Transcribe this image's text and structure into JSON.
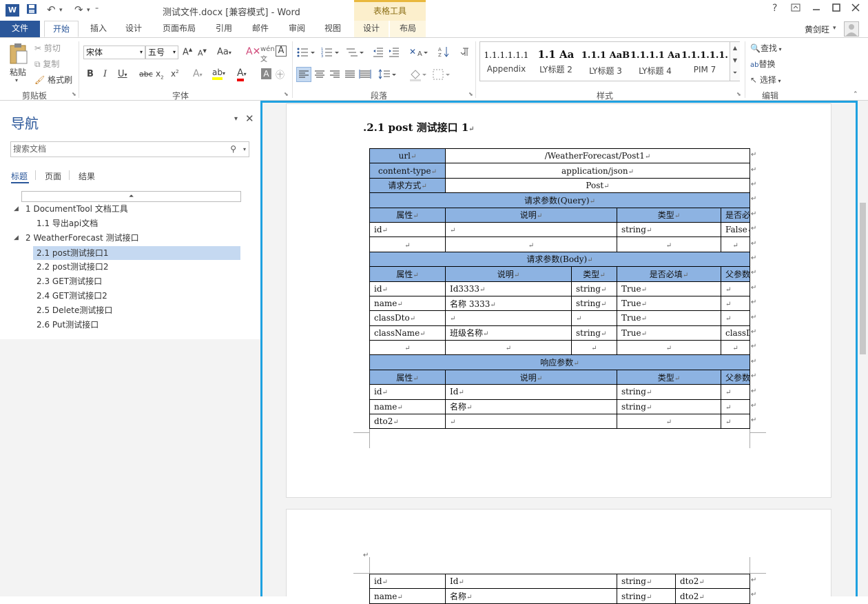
{
  "titlebar": {
    "app_icon": "W",
    "title": "测试文件.docx [兼容模式] - Word",
    "context_group": "表格工具",
    "help": "?",
    "icons": [
      "word-icon",
      "save-icon",
      "undo-icon",
      "redo-icon",
      "customize-qat-icon",
      "help-icon",
      "ribbon-display-icon",
      "minimize-icon",
      "maximize-icon",
      "close-icon"
    ]
  },
  "tabs": [
    "文件",
    "开始",
    "插入",
    "设计",
    "页面布局",
    "引用",
    "邮件",
    "审阅",
    "视图",
    "设计",
    "布局"
  ],
  "user": {
    "name": "黄剑旺"
  },
  "ribbon": {
    "clipboard": {
      "paste": "粘贴",
      "cut": "剪切",
      "copy": "复制",
      "format_painter": "格式刷",
      "label": "剪贴板"
    },
    "font": {
      "font_name": "宋体",
      "font_size": "五号",
      "label": "字体",
      "case": "Aa"
    },
    "paragraph": {
      "label": "段落"
    },
    "styles": {
      "label": "样式",
      "items": [
        {
          "preview": "1.1.1.1.1.1",
          "name": "Appendix"
        },
        {
          "preview": "1.1 Aa",
          "name": "LY标题 2"
        },
        {
          "preview": "1.1.1 AaB",
          "name": "LY标题 3"
        },
        {
          "preview": "1.1.1.1 Aa",
          "name": "LY标题 4"
        },
        {
          "preview": "1.1.1.1.1.",
          "name": "PIM 7"
        }
      ]
    },
    "editing": {
      "find": "查找",
      "replace": "替换",
      "select": "选择",
      "label": "编辑"
    }
  },
  "nav": {
    "title": "导航",
    "search_placeholder": "搜索文档",
    "tabs": [
      "标题",
      "页面",
      "结果"
    ],
    "tree": [
      {
        "text": "1 DocumentTool 文档工具",
        "level": 1,
        "expandable": true
      },
      {
        "text": "1.1 导出api文档",
        "level": 2
      },
      {
        "text": "2 WeatherForecast 测试接口",
        "level": 1,
        "expandable": true
      },
      {
        "text": "2.1 post测试接口1",
        "level": 2,
        "selected": true
      },
      {
        "text": "2.2 post测试接口2",
        "level": 2
      },
      {
        "text": "2.3 GET测试接口",
        "level": 2
      },
      {
        "text": "2.4 GET测试接口2",
        "level": 2
      },
      {
        "text": "2.5 Delete测试接口",
        "level": 2
      },
      {
        "text": "2.6 Put测试接口",
        "level": 2
      }
    ]
  },
  "document": {
    "heading": ".2.1   post 测试接口 1",
    "mark": "↵",
    "info": {
      "url_label": "url",
      "url": "/WeatherForecast/Post1",
      "ct_label": "content-type",
      "ct": "application/json",
      "method_label": "请求方式",
      "method": "Post"
    },
    "query": {
      "title": "请求参数(Query)",
      "headers": [
        "属性",
        "说明",
        "类型",
        "是否必填"
      ],
      "rows": [
        [
          "id",
          "",
          "string",
          "False"
        ],
        [
          "",
          "",
          "",
          ""
        ]
      ]
    },
    "body": {
      "title": "请求参数(Body)",
      "headers": [
        "属性",
        "说明",
        "类型",
        "是否必填",
        "父参数"
      ],
      "rows": [
        [
          "id",
          "Id3333",
          "string",
          "True",
          ""
        ],
        [
          "name",
          "名称 3333",
          "string",
          "True",
          ""
        ],
        [
          "classDto",
          "",
          "",
          "True",
          ""
        ],
        [
          "className",
          "班级名称",
          "string",
          "True",
          "classDto"
        ],
        [
          "",
          "",
          "",
          "",
          ""
        ]
      ]
    },
    "response": {
      "title": "响应参数",
      "headers": [
        "属性",
        "说明",
        "类型",
        "父参数"
      ],
      "rows": [
        [
          "id",
          "Id",
          "string",
          ""
        ],
        [
          "name",
          "名称",
          "string",
          ""
        ],
        [
          "dto2",
          "",
          "",
          ""
        ]
      ]
    },
    "page2_rows": [
      [
        "id",
        "Id",
        "string",
        "dto2"
      ],
      [
        "name",
        "名称",
        "string",
        "dto2"
      ]
    ]
  }
}
